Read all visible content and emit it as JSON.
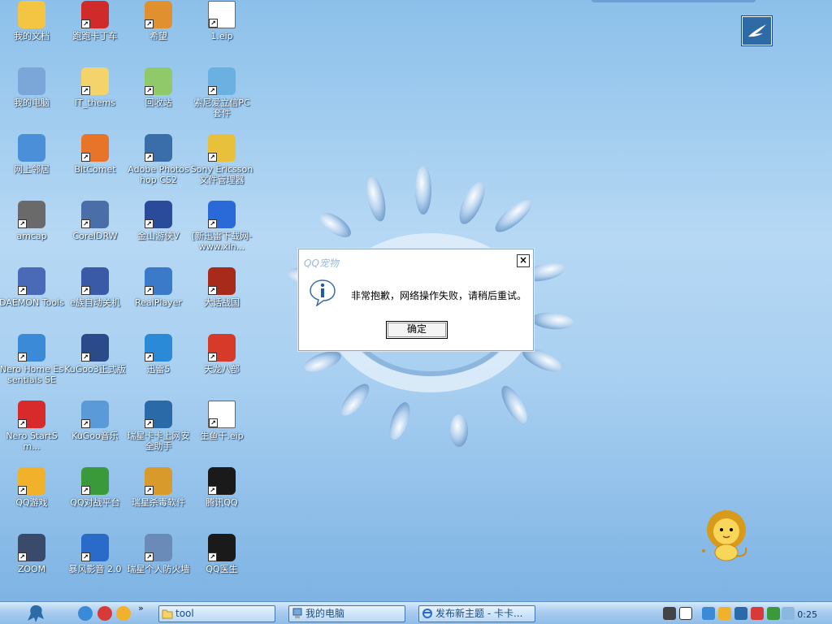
{
  "desktop": {
    "icons": [
      {
        "label": "我的文档",
        "icon": "folder-docs-icon",
        "color": "#f4c542"
      },
      {
        "label": "跑跑卡丁车",
        "icon": "kart-game-icon",
        "color": "#d12a2a"
      },
      {
        "label": "希望",
        "icon": "game-hope-icon",
        "color": "#e0902e"
      },
      {
        "label": "1.eip",
        "icon": "eip-file-icon",
        "color": "#ffffff"
      },
      {
        "label": "我的电脑",
        "icon": "computer-icon",
        "color": "#7aa7d8"
      },
      {
        "label": "IT_thems",
        "icon": "folder-icon",
        "color": "#f4d46a"
      },
      {
        "label": "回收站",
        "icon": "recycle-bin-icon",
        "color": "#8fc96a"
      },
      {
        "label": "索尼爱立信PC套件",
        "icon": "sony-pc-suite-icon",
        "color": "#6ab0e0"
      },
      {
        "label": "网上邻居",
        "icon": "network-icon",
        "color": "#4a8fd8"
      },
      {
        "label": "BitComet",
        "icon": "bitcomet-icon",
        "color": "#e8742a"
      },
      {
        "label": "Adobe Photoshop CS2",
        "icon": "photoshop-feather-icon",
        "color": "#3a6ea8"
      },
      {
        "label": "Sony Ericsson 文件管理器",
        "icon": "file-manager-icon",
        "color": "#e8c03a"
      },
      {
        "label": "amcap",
        "icon": "camera-icon",
        "color": "#6a6a6a"
      },
      {
        "label": "CorelDRW",
        "icon": "coreldraw-icon",
        "color": "#4a6ea8"
      },
      {
        "label": "金山游侠V",
        "icon": "kingsoft-icon",
        "color": "#2a4a9a"
      },
      {
        "label": "[新迅雷下载网-www.xin...",
        "icon": "realplayer-one-icon",
        "color": "#2a6ad8"
      },
      {
        "label": "DAEMON Tools",
        "icon": "daemon-tools-icon",
        "color": "#4a6ab8"
      },
      {
        "label": "e族自动关机",
        "icon": "shutdown-icon",
        "color": "#3a5aa8"
      },
      {
        "label": "RealPlayer",
        "icon": "realplayer-icon",
        "color": "#3a7ac8"
      },
      {
        "label": "大话战国",
        "icon": "warring-game-icon",
        "color": "#a82a1a"
      },
      {
        "label": "Nero Home Essentials SE",
        "icon": "nero-home-icon",
        "color": "#3a8ad8"
      },
      {
        "label": "KuGoo3正式版",
        "icon": "kugoo-icon",
        "color": "#2a4a8a"
      },
      {
        "label": "迅雷5",
        "icon": "thunder-icon",
        "color": "#2a8ad8"
      },
      {
        "label": "天龙八部",
        "icon": "tianlong-game-icon",
        "color": "#d83a2a"
      },
      {
        "label": "Nero StartSm...",
        "icon": "nero-icon",
        "color": "#d82a2a"
      },
      {
        "label": "KuGoo音乐",
        "icon": "kugoo-music-icon",
        "color": "#5a9ad8"
      },
      {
        "label": "瑞星卡卡上网安全助手",
        "icon": "rising-kaka-icon",
        "color": "#2a6aa8"
      },
      {
        "label": "生鱼干.eip",
        "icon": "eip-file-icon",
        "color": "#ffffff"
      },
      {
        "label": "QQ游戏",
        "icon": "qq-game-icon",
        "color": "#f2b12a"
      },
      {
        "label": "QQ对战平台",
        "icon": "qq-battle-icon",
        "color": "#3a9a3a"
      },
      {
        "label": "瑞星杀毒软件",
        "icon": "rising-antivirus-icon",
        "color": "#d89a2a"
      },
      {
        "label": "腾讯QQ",
        "icon": "qq-penguin-icon",
        "color": "#1a1a1a"
      },
      {
        "label": "ZOOM",
        "icon": "binoculars-icon",
        "color": "#3a4a6a"
      },
      {
        "label": "暴风影音 2.0",
        "icon": "storm-player-icon",
        "color": "#2a6ac8"
      },
      {
        "label": "瑞星个人防火墙",
        "icon": "firewall-icon",
        "color": "#6a8ab8"
      },
      {
        "label": "QQ医生",
        "icon": "qq-doctor-icon",
        "color": "#1a1a1a"
      }
    ]
  },
  "dialog": {
    "title": "QQ宠物",
    "close_label": "×",
    "message": "非常抱歉，网络操作失败，请稍后重试。",
    "ok_label": "确定",
    "icon": "info-icon"
  },
  "taskbar": {
    "start_icon": "qq-start-icon",
    "more_label": "»",
    "tasks": [
      {
        "label": "tool",
        "icon": "folder-icon"
      },
      {
        "label": "我的电脑",
        "icon": "computer-icon"
      },
      {
        "label": "发布新主题 - 卡卡...",
        "icon": "ie-icon"
      }
    ],
    "clock": "0:25"
  },
  "colors": {
    "desktop_top": "#8cc0ea",
    "desktop_bottom": "#79b0e2",
    "taskbar": "#a9cdf0",
    "task_text": "#1c4d86"
  }
}
